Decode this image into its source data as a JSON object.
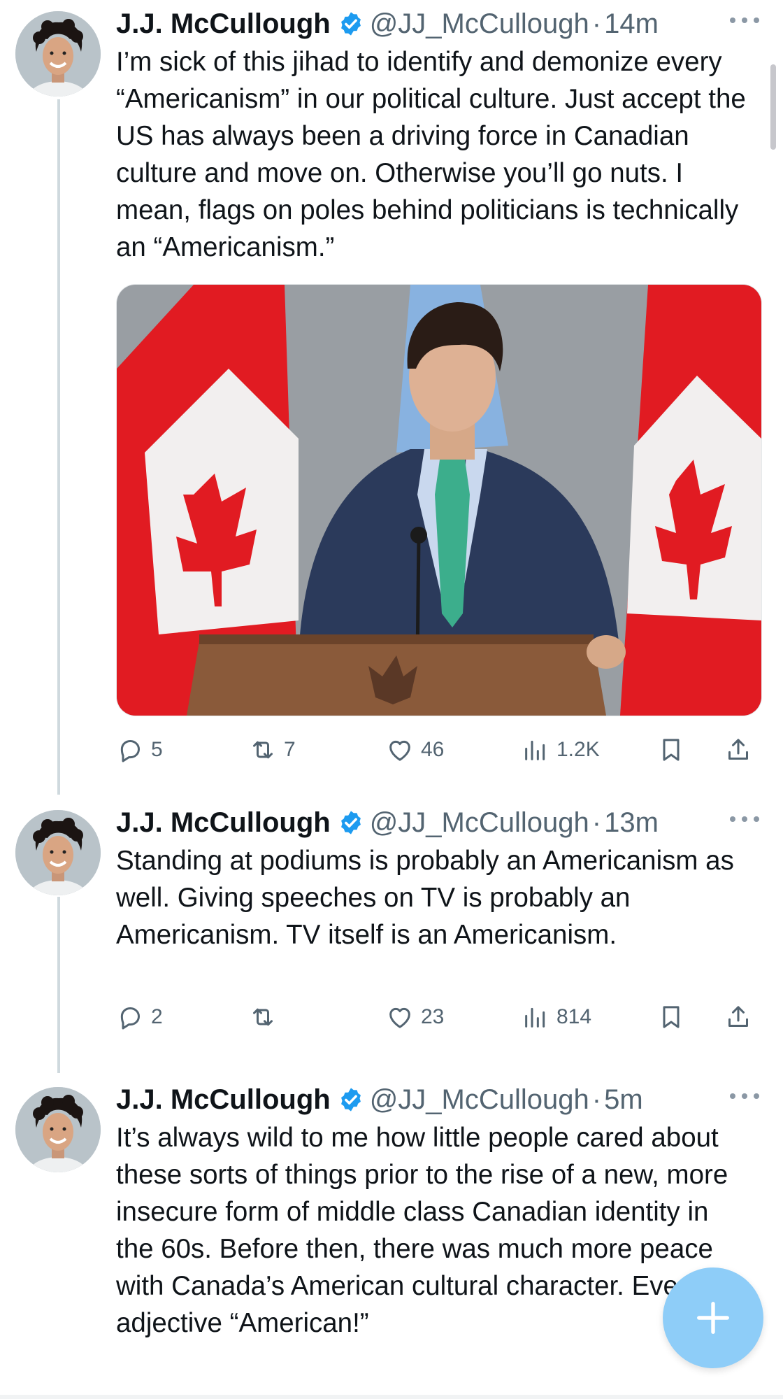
{
  "colors": {
    "verified": "#1d9bf0",
    "secondary_text": "#536471",
    "fab": "#8ecdf8",
    "thread_line": "#cfd9de"
  },
  "tweets": [
    {
      "name": "J.J. McCullough",
      "handle": "@JJ_McCullough",
      "dot": "·",
      "time": "14m",
      "text": "I’m sick of this jihad to identify and demonize every “Americanism” in our political culture. Just accept the US has always been a driving force in Canadian culture and move on. Otherwise you’ll go nuts. I mean, flags on poles behind politicians is technically an “Americanism.”",
      "has_media": true,
      "stats": {
        "replies": "5",
        "retweets": "7",
        "likes": "46",
        "views": "1.2K"
      }
    },
    {
      "name": "J.J. McCullough",
      "handle": "@JJ_McCullough",
      "dot": "·",
      "time": "13m",
      "text": "Standing at podiums is probably an Americanism as well. Giving speeches on TV is probably an Americanism. TV itself is an Americanism.",
      "has_media": false,
      "stats": {
        "replies": "2",
        "retweets": "",
        "likes": "23",
        "views": "814"
      }
    },
    {
      "name": "J.J. McCullough",
      "handle": "@JJ_McCullough",
      "dot": "·",
      "time": "5m",
      "text": "It’s always wild to me how little people cared about these sorts of things prior to the rise of a new, more insecure form of middle class Canadian identity in the 60s. Before then, there was much more peace with Canada’s American cultural character. Even the adjective “American!”",
      "has_media": false,
      "stats": null
    }
  ],
  "icons": {
    "reply": "reply-icon",
    "retweet": "retweet-icon",
    "like": "heart-icon",
    "views": "views-chart-icon",
    "bookmark": "bookmark-icon",
    "share": "share-icon",
    "more": "more-dots-icon",
    "verified": "verified-badge-icon",
    "compose": "plus-icon"
  }
}
